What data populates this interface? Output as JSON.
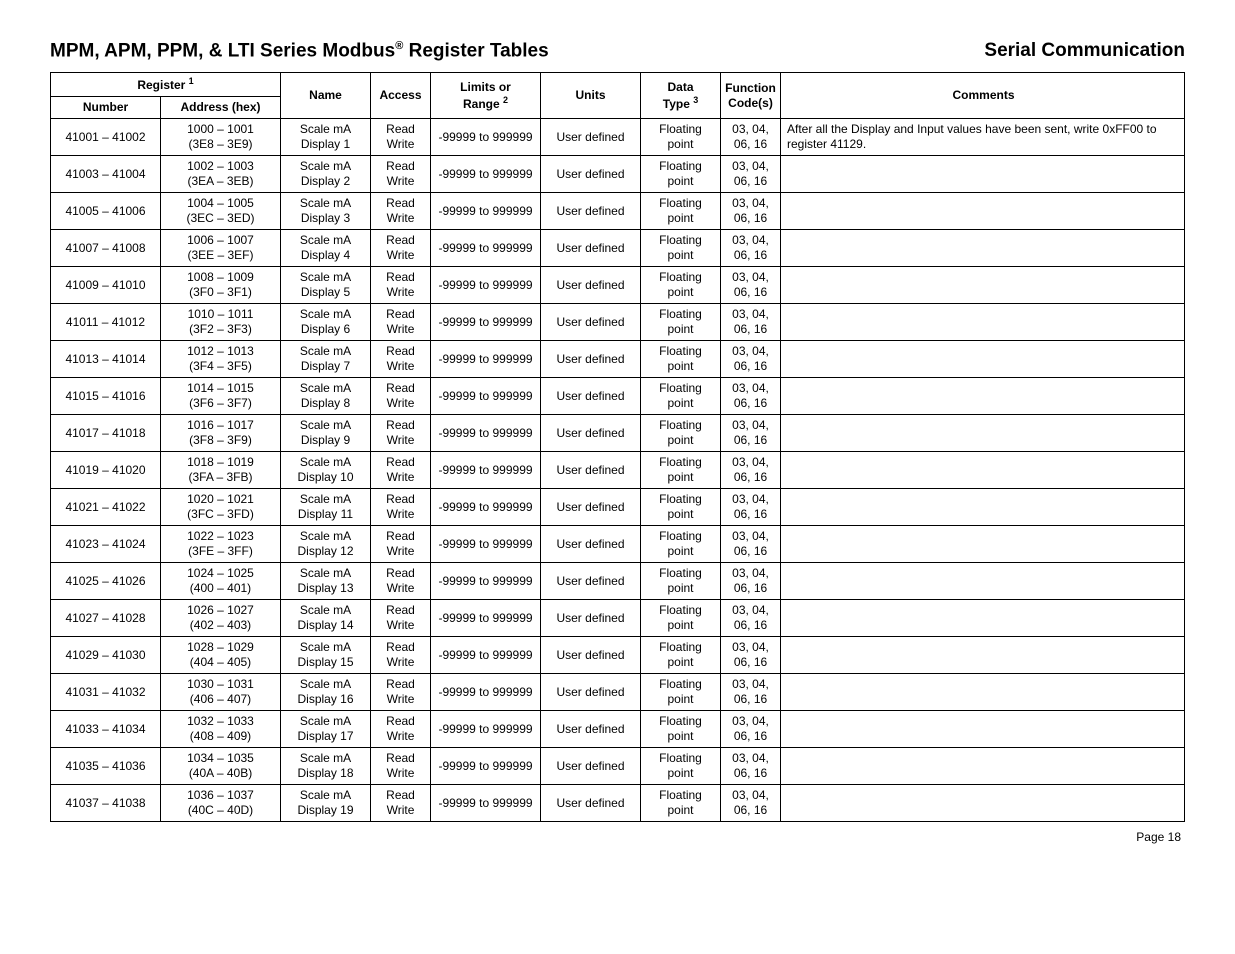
{
  "header": {
    "title_left_1": "MPM, APM, PPM, & LTI Series Modbus",
    "title_left_sup": "®",
    "title_left_2": " Register Tables",
    "title_right": "Serial Communication"
  },
  "table": {
    "head": {
      "register_group": "Register ",
      "register_sup": "1",
      "number": "Number",
      "address": "Address (hex)",
      "name": "Name",
      "access": "Access",
      "limits_1": "Limits or",
      "limits_2": "Range ",
      "limits_sup": "2",
      "units": "Units",
      "data_1": "Data",
      "data_2": "Type ",
      "data_sup": "3",
      "func_1": "Function",
      "func_2": "Code(s)",
      "comments": "Comments"
    },
    "rows": [
      {
        "number": "41001 – 41002",
        "addr1": "1000 – 1001",
        "addr2": "(3E8 – 3E9)",
        "name1": "Scale mA",
        "name2": "Display 1",
        "access": "Read Write",
        "limits": "-99999 to 999999",
        "units": "User defined",
        "dtype": "Floating point",
        "func1": "03, 04,",
        "func2": "06, 16",
        "comments": "After all the Display and Input values have been sent, write 0xFF00 to register 41129."
      },
      {
        "number": "41003 – 41004",
        "addr1": "1002 – 1003",
        "addr2": "(3EA – 3EB)",
        "name1": "Scale mA",
        "name2": "Display 2",
        "access": "Read Write",
        "limits": "-99999 to 999999",
        "units": "User defined",
        "dtype": "Floating point",
        "func1": "03, 04,",
        "func2": "06, 16",
        "comments": ""
      },
      {
        "number": "41005 – 41006",
        "addr1": "1004 – 1005",
        "addr2": "(3EC – 3ED)",
        "name1": "Scale mA",
        "name2": "Display 3",
        "access": "Read Write",
        "limits": "-99999 to 999999",
        "units": "User defined",
        "dtype": "Floating point",
        "func1": "03, 04,",
        "func2": "06, 16",
        "comments": ""
      },
      {
        "number": "41007 – 41008",
        "addr1": "1006 – 1007",
        "addr2": "(3EE – 3EF)",
        "name1": "Scale mA",
        "name2": "Display 4",
        "access": "Read Write",
        "limits": "-99999 to 999999",
        "units": "User defined",
        "dtype": "Floating point",
        "func1": "03, 04,",
        "func2": "06, 16",
        "comments": ""
      },
      {
        "number": "41009 – 41010",
        "addr1": "1008 – 1009",
        "addr2": "(3F0 – 3F1)",
        "name1": "Scale mA",
        "name2": "Display 5",
        "access": "Read Write",
        "limits": "-99999 to 999999",
        "units": "User defined",
        "dtype": "Floating point",
        "func1": "03, 04,",
        "func2": "06, 16",
        "comments": ""
      },
      {
        "number": "41011 – 41012",
        "addr1": "1010 – 1011",
        "addr2": "(3F2 – 3F3)",
        "name1": "Scale mA",
        "name2": "Display 6",
        "access": "Read Write",
        "limits": "-99999 to 999999",
        "units": "User defined",
        "dtype": "Floating point",
        "func1": "03, 04,",
        "func2": "06, 16",
        "comments": ""
      },
      {
        "number": "41013 – 41014",
        "addr1": "1012 – 1013",
        "addr2": "(3F4 – 3F5)",
        "name1": "Scale mA",
        "name2": "Display 7",
        "access": "Read Write",
        "limits": "-99999 to 999999",
        "units": "User defined",
        "dtype": "Floating point",
        "func1": "03, 04,",
        "func2": "06, 16",
        "comments": ""
      },
      {
        "number": "41015 – 41016",
        "addr1": "1014 – 1015",
        "addr2": "(3F6 – 3F7)",
        "name1": "Scale mA",
        "name2": "Display 8",
        "access": "Read Write",
        "limits": "-99999 to 999999",
        "units": "User defined",
        "dtype": "Floating point",
        "func1": "03, 04,",
        "func2": "06, 16",
        "comments": ""
      },
      {
        "number": "41017 – 41018",
        "addr1": "1016 – 1017",
        "addr2": "(3F8 – 3F9)",
        "name1": "Scale mA",
        "name2": "Display 9",
        "access": "Read Write",
        "limits": "-99999 to 999999",
        "units": "User defined",
        "dtype": "Floating point",
        "func1": "03, 04,",
        "func2": "06, 16",
        "comments": ""
      },
      {
        "number": "41019 – 41020",
        "addr1": "1018 – 1019",
        "addr2": "(3FA – 3FB)",
        "name1": "Scale mA",
        "name2": "Display 10",
        "access": "Read Write",
        "limits": "-99999 to 999999",
        "units": "User defined",
        "dtype": "Floating point",
        "func1": "03, 04,",
        "func2": "06, 16",
        "comments": ""
      },
      {
        "number": "41021 – 41022",
        "addr1": "1020 – 1021",
        "addr2": "(3FC – 3FD)",
        "name1": "Scale mA",
        "name2": "Display 11",
        "access": "Read Write",
        "limits": "-99999 to 999999",
        "units": "User defined",
        "dtype": "Floating point",
        "func1": "03, 04,",
        "func2": "06, 16",
        "comments": ""
      },
      {
        "number": "41023 – 41024",
        "addr1": "1022 – 1023",
        "addr2": "(3FE – 3FF)",
        "name1": "Scale mA",
        "name2": "Display 12",
        "access": "Read Write",
        "limits": "-99999 to 999999",
        "units": "User defined",
        "dtype": "Floating point",
        "func1": "03, 04,",
        "func2": "06, 16",
        "comments": ""
      },
      {
        "number": "41025 – 41026",
        "addr1": "1024 – 1025",
        "addr2": "(400 – 401)",
        "name1": "Scale mA",
        "name2": "Display 13",
        "access": "Read Write",
        "limits": "-99999 to 999999",
        "units": "User defined",
        "dtype": "Floating point",
        "func1": "03, 04,",
        "func2": "06, 16",
        "comments": ""
      },
      {
        "number": "41027 –  41028",
        "addr1": "1026 – 1027",
        "addr2": "(402 – 403)",
        "name1": "Scale mA",
        "name2": "Display 14",
        "access": "Read Write",
        "limits": "-99999 to 999999",
        "units": "User defined",
        "dtype": "Floating point",
        "func1": "03, 04,",
        "func2": "06, 16",
        "comments": ""
      },
      {
        "number": "41029 – 41030",
        "addr1": "1028 – 1029",
        "addr2": "(404 – 405)",
        "name1": "Scale mA",
        "name2": "Display 15",
        "access": "Read Write",
        "limits": "-99999 to 999999",
        "units": "User defined",
        "dtype": "Floating point",
        "func1": "03, 04,",
        "func2": "06, 16",
        "comments": ""
      },
      {
        "number": "41031 – 41032",
        "addr1": "1030 – 1031",
        "addr2": "(406 – 407)",
        "name1": "Scale mA",
        "name2": "Display 16",
        "access": "Read Write",
        "limits": "-99999 to 999999",
        "units": "User defined",
        "dtype": "Floating point",
        "func1": "03, 04,",
        "func2": "06, 16",
        "comments": ""
      },
      {
        "number": "41033 – 41034",
        "addr1": "1032 – 1033",
        "addr2": "(408 – 409)",
        "name1": "Scale mA",
        "name2": "Display 17",
        "access": "Read Write",
        "limits": "-99999 to 999999",
        "units": "User defined",
        "dtype": "Floating point",
        "func1": "03, 04,",
        "func2": "06, 16",
        "comments": ""
      },
      {
        "number": "41035 – 41036",
        "addr1": "1034 – 1035",
        "addr2": "(40A – 40B)",
        "name1": "Scale mA",
        "name2": "Display 18",
        "access": "Read Write",
        "limits": "-99999 to 999999",
        "units": "User defined",
        "dtype": "Floating point",
        "func1": "03, 04,",
        "func2": "06, 16",
        "comments": ""
      },
      {
        "number": "41037 – 41038",
        "addr1": "1036 – 1037",
        "addr2": "(40C – 40D)",
        "name1": "Scale mA",
        "name2": "Display 19",
        "access": "Read Write",
        "limits": "-99999 to 999999",
        "units": "User defined",
        "dtype": "Floating point",
        "func1": "03, 04,",
        "func2": "06, 16",
        "comments": ""
      }
    ]
  },
  "footer": {
    "page": "Page 18"
  }
}
